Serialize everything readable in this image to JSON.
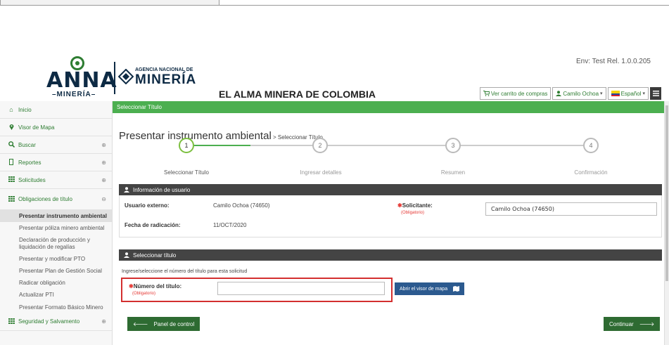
{
  "header": {
    "logo_word": "ANNA",
    "logo_sub": "–MINERÍA–",
    "agency_small": "AGENCIA NACIONAL DE",
    "agency_big": "MINERÍA",
    "slogan": "EL ALMA MINERA DE COLOMBIA",
    "env": "Env: Test Rel. 1.0.0.205",
    "cart_label": "Ver carrito de compras",
    "user_label": "Camilo Ochoa",
    "language_label": "Español",
    "icons": {
      "cart": "cart-icon",
      "user": "user-icon",
      "menu": "hamburger-icon",
      "flag": "colombia-flag-icon"
    }
  },
  "sidebar": {
    "items": [
      {
        "label": "Inicio",
        "icon": "home-icon"
      },
      {
        "label": "Visor de Mapa",
        "icon": "map-pin-icon"
      },
      {
        "label": "Buscar",
        "icon": "search-icon",
        "expand": "⊕"
      },
      {
        "label": "Reportes",
        "icon": "document-icon",
        "expand": "⊕"
      },
      {
        "label": "Solicitudes",
        "icon": "grid-icon",
        "expand": "⊕"
      },
      {
        "label": "Obligaciones de título",
        "icon": "grid-icon",
        "expand": "⊖"
      }
    ],
    "subitems": [
      "Presentar instrumento ambiental",
      "Presentar póliza minero ambiental",
      "Declaración de producción y liquidación de regalías",
      "Presentar y modificar PTO",
      "Presentar Plan de Gestión Social",
      "Radicar obligación",
      "Actualizar PTI",
      "Presentar Formato Básico Minero"
    ],
    "last_item": {
      "label": "Seguridad y Salvamento",
      "icon": "grid-icon",
      "expand": "⊕"
    }
  },
  "main": {
    "green_bar": "Seleccionar Título",
    "title": "Presentar instrumento ambiental",
    "breadcrumb": " > Seleccionar Título",
    "steps": [
      {
        "num": "1",
        "label": "Seleccionar Título"
      },
      {
        "num": "2",
        "label": "Ingresar detalles"
      },
      {
        "num": "3",
        "label": "Resumen"
      },
      {
        "num": "4",
        "label": "Confirmación"
      }
    ],
    "user_panel": {
      "title": "Información de usuario",
      "external_user_label": "Usuario externo:",
      "external_user_value": "Camilo Ochoa (74650)",
      "date_label": "Fecha de radicación:",
      "date_value": "11/OCT/2020",
      "requester_label": "Solicitante:",
      "required_text": "(Obligatorio)",
      "requester_value": "Camilo Ochoa (74650)"
    },
    "title_panel": {
      "title": "Seleccionar título",
      "instruction": "Ingrese/seleccione el número del título para esta solicitud",
      "field_label": "Número del título:",
      "required_text": "(Obligatorio)",
      "field_value": "",
      "map_button": "Abrir el visor de mapa"
    },
    "buttons": {
      "back": "Panel de control",
      "continue": "Continuar"
    }
  },
  "colors": {
    "brand_green": "#4caf50",
    "dark_green": "#2e6b32",
    "panel_dark": "#444444",
    "highlight_red": "#d32f2f",
    "map_blue": "#2c5a8f"
  }
}
